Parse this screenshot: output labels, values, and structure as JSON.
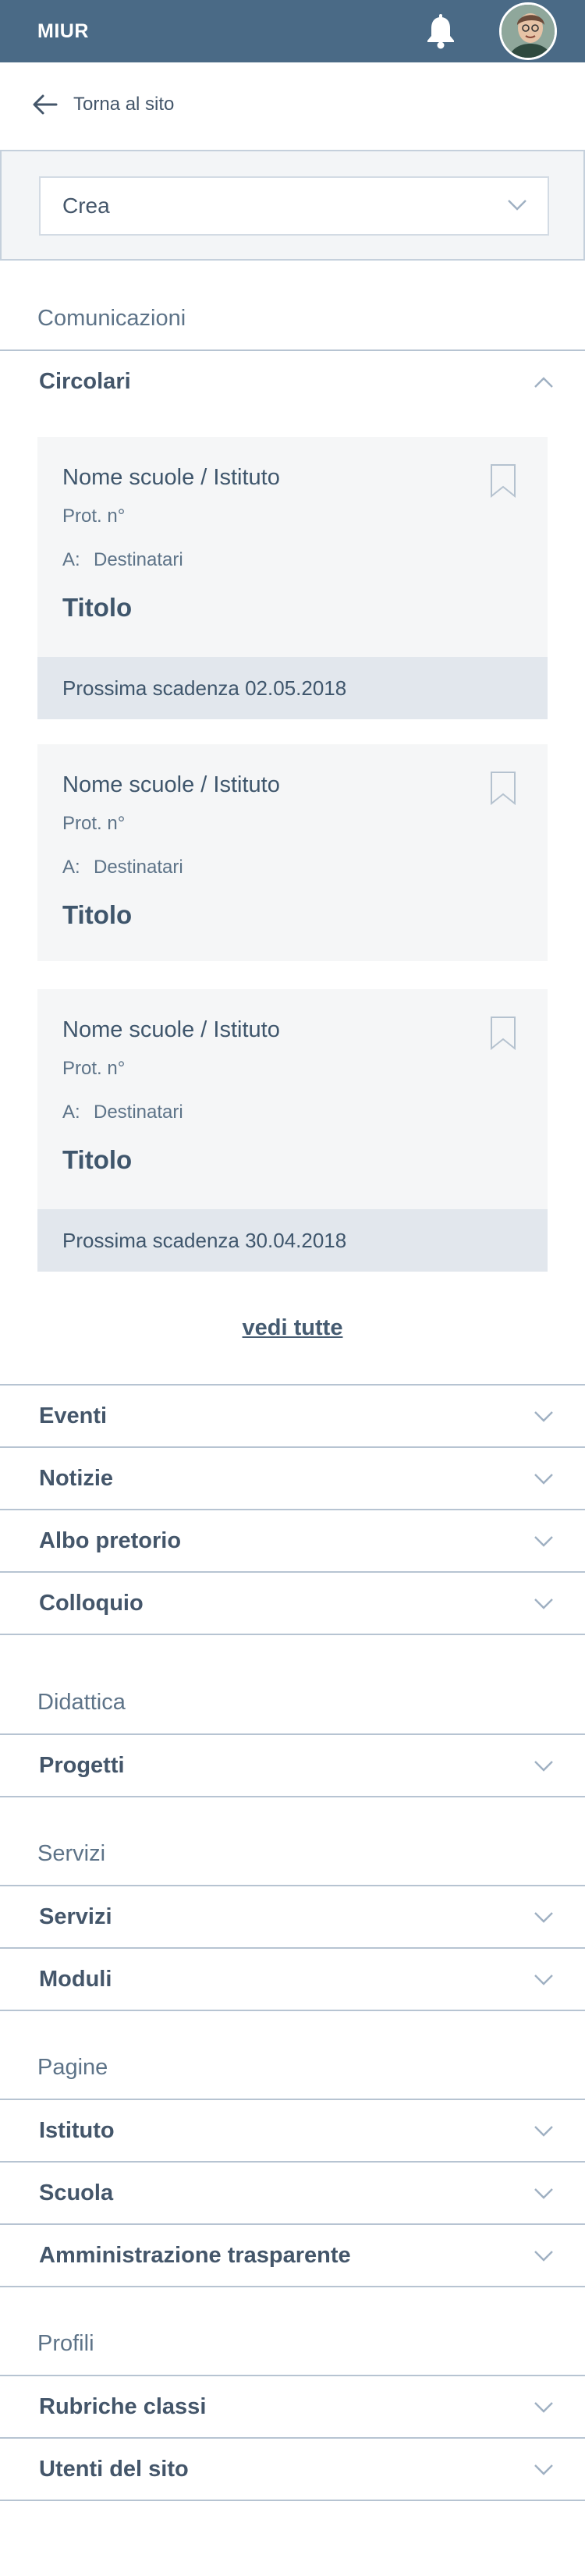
{
  "header": {
    "brand": "MIUR",
    "bell_icon": "bell-icon",
    "avatar_icon": "user-avatar"
  },
  "back": {
    "label": "Torna al sito",
    "icon": "arrow-left-icon"
  },
  "crea": {
    "label": "Crea",
    "icon": "chevron-down-icon"
  },
  "sections": {
    "comunicazioni": "Comunicazioni",
    "didattica": "Didattica",
    "servizi": "Servizi",
    "pagine": "Pagine",
    "profili": "Profili"
  },
  "circolari": {
    "label": "Circolari",
    "expanded": true,
    "cards": [
      {
        "school": "Nome scuole / Istituto",
        "prot": "Prot. n°",
        "a_label": "A:",
        "recipients": "Destinatari",
        "title": "Titolo",
        "deadline": "Prossima scadenza 02.05.2018"
      },
      {
        "school": "Nome scuole / Istituto",
        "prot": "Prot. n°",
        "a_label": "A:",
        "recipients": "Destinatari",
        "title": "Titolo",
        "deadline": ""
      },
      {
        "school": "Nome scuole / Istituto",
        "prot": "Prot. n°",
        "a_label": "A:",
        "recipients": "Destinatari",
        "title": "Titolo",
        "deadline": "Prossima scadenza 30.04.2018"
      }
    ],
    "see_all": "vedi tutte"
  },
  "menus": {
    "comunicazioni": [
      "Eventi",
      "Notizie",
      "Albo pretorio",
      "Colloquio"
    ],
    "didattica": [
      "Progetti"
    ],
    "servizi": [
      "Servizi",
      "Moduli"
    ],
    "pagine": [
      "Istituto",
      "Scuola",
      "Amministrazione trasparente"
    ],
    "profili": [
      "Rubriche classi",
      "Utenti del sito"
    ]
  },
  "colors": {
    "header_bg": "#4a6a86",
    "text": "#455b71",
    "card_bg": "#f5f6f7",
    "deadline_bg": "#e2e7ed",
    "divider": "#b7c4d2"
  }
}
